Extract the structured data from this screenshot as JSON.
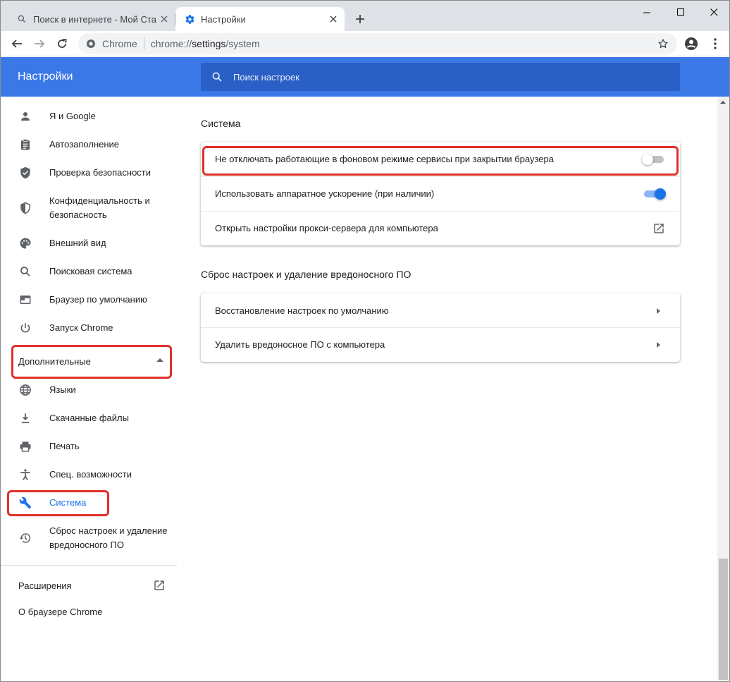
{
  "tabs": [
    {
      "title": "Поиск в интернете - Мой Старт",
      "icon": "search-icon"
    },
    {
      "title": "Настройки",
      "icon": "gear-icon"
    }
  ],
  "toolbar": {
    "site_name": "Chrome",
    "url_scheme": "chrome://",
    "url_host": "settings",
    "url_path": "/system"
  },
  "header": {
    "title": "Настройки",
    "search_placeholder": "Поиск настроек"
  },
  "sidebar": {
    "items": [
      {
        "label": "Я и Google",
        "icon": "person-icon"
      },
      {
        "label": "Автозаполнение",
        "icon": "clipboard-icon"
      },
      {
        "label": "Проверка безопасности",
        "icon": "shield-check-icon"
      },
      {
        "label": "Конфиденциальность и безопасность",
        "icon": "shield-half-icon"
      },
      {
        "label": "Внешний вид",
        "icon": "palette-icon"
      },
      {
        "label": "Поисковая система",
        "icon": "search-icon"
      },
      {
        "label": "Браузер по умолчанию",
        "icon": "browser-window-icon"
      },
      {
        "label": "Запуск Chrome",
        "icon": "power-icon"
      }
    ],
    "advanced_label": "Дополнительные",
    "advanced_items": [
      {
        "label": "Языки",
        "icon": "globe-icon"
      },
      {
        "label": "Скачанные файлы",
        "icon": "download-icon"
      },
      {
        "label": "Печать",
        "icon": "printer-icon"
      },
      {
        "label": "Спец. возможности",
        "icon": "accessibility-icon"
      },
      {
        "label": "Система",
        "icon": "wrench-icon",
        "active": true
      },
      {
        "label": "Сброс настроек и удаление вредоносного ПО",
        "icon": "restore-icon"
      }
    ],
    "extensions_label": "Расширения",
    "about_label": "О браузере Chrome"
  },
  "main": {
    "system_section": {
      "title": "Система",
      "rows": [
        {
          "label": "Не отключать работающие в фоновом режиме сервисы при закрытии браузера",
          "control": "toggle",
          "state": "off"
        },
        {
          "label": "Использовать аппаратное ускорение (при наличии)",
          "control": "toggle",
          "state": "on"
        },
        {
          "label": "Открыть настройки прокси-сервера для компьютера",
          "control": "external-link"
        }
      ]
    },
    "reset_section": {
      "title": "Сброс настроек и удаление вредоносного ПО",
      "rows": [
        {
          "label": "Восстановление настроек по умолчанию"
        },
        {
          "label": "Удалить вредоносное ПО с компьютера"
        }
      ]
    }
  },
  "colors": {
    "accent": "#1a73e8",
    "header_bg": "#3b78e7",
    "highlight_box": "#e0312a"
  }
}
